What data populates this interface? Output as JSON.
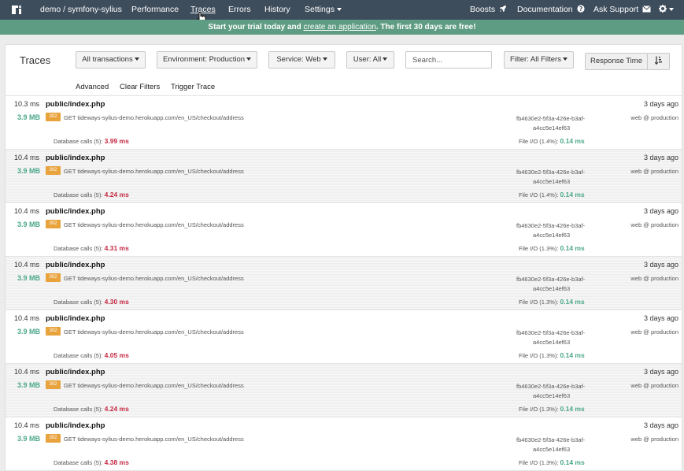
{
  "nav": {
    "project": "demo  / symfony-sylius",
    "items": [
      "Performance",
      "Traces",
      "Errors",
      "History",
      "Settings"
    ],
    "right": [
      "Boosts",
      "Documentation",
      "Ask Support"
    ]
  },
  "banner": {
    "prefix": "Start your trial today and ",
    "link": "create an application",
    "suffix": ". The first 30 days are free!"
  },
  "page": {
    "title": "Traces",
    "filters": {
      "transactions": "All transactions",
      "environment": "Environment: Production",
      "service": "Service: Web",
      "user": "User: All",
      "search_placeholder": "Search...",
      "filter": "Filter: All Filters",
      "sort": "Response Time"
    },
    "sublinks": [
      "Advanced",
      "Clear Filters",
      "Trigger Trace"
    ]
  },
  "traces": [
    {
      "duration": "10.3 ms",
      "path": "public/index.php",
      "age": "3 days ago",
      "memory": "3.9 MB",
      "status": "302",
      "request": "GET tideways-sylius-demo.herokuapp.com/en_US/checkout/address",
      "trace_id_1": "fb4630e2-5f3a-426e-b3af-",
      "trace_id_2": "a4cc5e14ef63",
      "env": "web @ production",
      "db_label": "Database calls (5):",
      "db_time": "3.99 ms",
      "fio_label": "File I/O (1.4%):",
      "fio_time": "0.14 ms"
    },
    {
      "duration": "10.4 ms",
      "path": "public/index.php",
      "age": "3 days ago",
      "memory": "3.9 MB",
      "status": "302",
      "request": "GET tideways-sylius-demo.herokuapp.com/en_US/checkout/address",
      "trace_id_1": "fb4630e2-5f3a-426e-b3af-",
      "trace_id_2": "a4cc5e14ef63",
      "env": "web @ production",
      "db_label": "Database calls (5):",
      "db_time": "4.24 ms",
      "fio_label": "File I/O (1.4%):",
      "fio_time": "0.14 ms"
    },
    {
      "duration": "10.4 ms",
      "path": "public/index.php",
      "age": "3 days ago",
      "memory": "3.9 MB",
      "status": "302",
      "request": "GET tideways-sylius-demo.herokuapp.com/en_US/checkout/address",
      "trace_id_1": "fb4630e2-5f3a-426e-b3af-",
      "trace_id_2": "a4cc5e14ef63",
      "env": "web @ production",
      "db_label": "Database calls (5):",
      "db_time": "4.31 ms",
      "fio_label": "File I/O (1.3%):",
      "fio_time": "0.14 ms"
    },
    {
      "duration": "10.4 ms",
      "path": "public/index.php",
      "age": "3 days ago",
      "memory": "3.9 MB",
      "status": "302",
      "request": "GET tideways-sylius-demo.herokuapp.com/en_US/checkout/address",
      "trace_id_1": "fb4630e2-5f3a-426e-b3af-",
      "trace_id_2": "a4cc5e14ef63",
      "env": "web @ production",
      "db_label": "Database calls (5):",
      "db_time": "4.30 ms",
      "fio_label": "File I/O (1.3%):",
      "fio_time": "0.14 ms"
    },
    {
      "duration": "10.4 ms",
      "path": "public/index.php",
      "age": "3 days ago",
      "memory": "3.9 MB",
      "status": "302",
      "request": "GET tideways-sylius-demo.herokuapp.com/en_US/checkout/address",
      "trace_id_1": "fb4630e2-5f3a-426e-b3af-",
      "trace_id_2": "a4cc5e14ef63",
      "env": "web @ production",
      "db_label": "Database calls (5):",
      "db_time": "4.05 ms",
      "fio_label": "File I/O (1.3%):",
      "fio_time": "0.14 ms"
    },
    {
      "duration": "10.4 ms",
      "path": "public/index.php",
      "age": "3 days ago",
      "memory": "3.9 MB",
      "status": "302",
      "request": "GET tideways-sylius-demo.herokuapp.com/en_US/checkout/address",
      "trace_id_1": "fb4630e2-5f3a-426e-b3af-",
      "trace_id_2": "a4cc5e14ef63",
      "env": "web @ production",
      "db_label": "Database calls (5):",
      "db_time": "4.24 ms",
      "fio_label": "File I/O (1.3%):",
      "fio_time": "0.14 ms"
    },
    {
      "duration": "10.4 ms",
      "path": "public/index.php",
      "age": "3 days ago",
      "memory": "3.9 MB",
      "status": "302",
      "request": "GET tideways-sylius-demo.herokuapp.com/en_US/checkout/address",
      "trace_id_1": "fb4630e2-5f3a-426e-b3af-",
      "trace_id_2": "a4cc5e14ef63",
      "env": "web @ production",
      "db_label": "Database calls (5):",
      "db_time": "4.38 ms",
      "fio_label": "File I/O (1.3%):",
      "fio_time": "0.14 ms"
    }
  ]
}
